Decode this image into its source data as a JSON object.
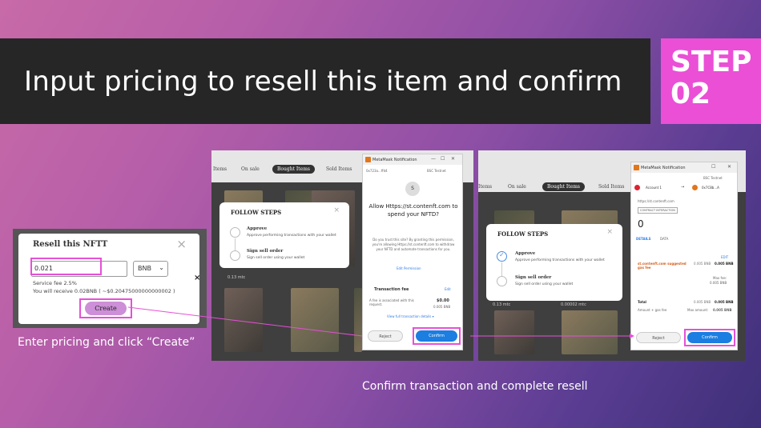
{
  "header": {
    "title": "Input pricing to resell this item and confirm"
  },
  "step": {
    "word": "STEP",
    "number": "02"
  },
  "captions": {
    "left": "Enter pricing and click “Create”",
    "bottom": "Confirm transaction and complete resell"
  },
  "resell_dialog": {
    "title": "Resell this NFTT",
    "close": "×",
    "price_value": "0.021",
    "currency": "BNB",
    "service_fee": "Service fee 2.5%",
    "receive": "You will receive 0.02BNB  ( ~$0.20475000000000002 )",
    "create_label": "Create",
    "side_close": "×"
  },
  "shot1": {
    "tabs": {
      "left": "Items",
      "onsale": "On sale",
      "bought": "Bought Items",
      "sold": "Sold Items"
    },
    "price_sample": "0.13 mtc",
    "steps_title": "FOLLOW STEPS",
    "steps": [
      {
        "title": "Approve",
        "desc": "Approve performing transactions with your wallet"
      },
      {
        "title": "Sign sell order",
        "desc": "Sign sell order using your wallet"
      }
    ],
    "metamask": {
      "bar_title": "MetaMask Notification",
      "account": "0x723a...ffd4",
      "network": "BSC Testnet",
      "avatar_letter": "S",
      "heading": "Allow Https://st.contenft.com to spend your NFTD?",
      "body": "Do you trust this site? By granting this permission, you're allowing Https://st.contenft.com to withdraw your NFTD and automate transactions for you.",
      "edit_permission": "Edit Permission",
      "fee_label": "Transaction fee",
      "fee_edit": "Edit",
      "fee_note": "A fee is associated with this request.",
      "fee_usd": "$0.00",
      "fee_bnb": "0.005 BNB",
      "view_details": "View full transaction details ▾",
      "reject": "Reject",
      "confirm": "Confirm"
    }
  },
  "shot2": {
    "tabs": {
      "left": "Items",
      "onsale": "On sale",
      "bought": "Bought Items",
      "sold": "Sold Items"
    },
    "price_sample": "0.13 mtc",
    "price_sample2": "0.00002 mtc",
    "steps_title": "FOLLOW STEPS",
    "steps": [
      {
        "title": "Approve",
        "desc": "Approve performing transactions with your wallet"
      },
      {
        "title": "Sign sell order",
        "desc": "Sign sell order using your wallet"
      }
    ],
    "metamask": {
      "bar_title": "MetaMask Notification",
      "network": "BSC Testnet",
      "account": "Account 1",
      "arrow": "→",
      "to": "0x7C8b...A",
      "url": "https://st.contenft.com",
      "badge": "CONTRACT INTERACTION",
      "amount": "0",
      "tab_details": "DETAILS",
      "tab_data": "DATA",
      "edit": "EDIT",
      "gas_label": "st.contenft.com suggested gas fee",
      "gas_value": "0.005 BNB",
      "gas_value_bold": "0.005 BNB",
      "max_fee": "Max fee:",
      "max_fee_value": "0.005 BNB",
      "total_label": "Total",
      "total_value": "0.005 BNB",
      "total_bold": "0.005 BNB",
      "amount_gas": "Amount + gas fee",
      "max_amount": "Max amount:",
      "max_amount_value": "0.005 BNB",
      "reject": "Reject",
      "confirm": "Confirm"
    }
  },
  "colors": {
    "highlight": "#e650d8",
    "step_bg": "#ea4fd6",
    "title_bg": "#262626",
    "confirm": "#1b7ee0"
  }
}
